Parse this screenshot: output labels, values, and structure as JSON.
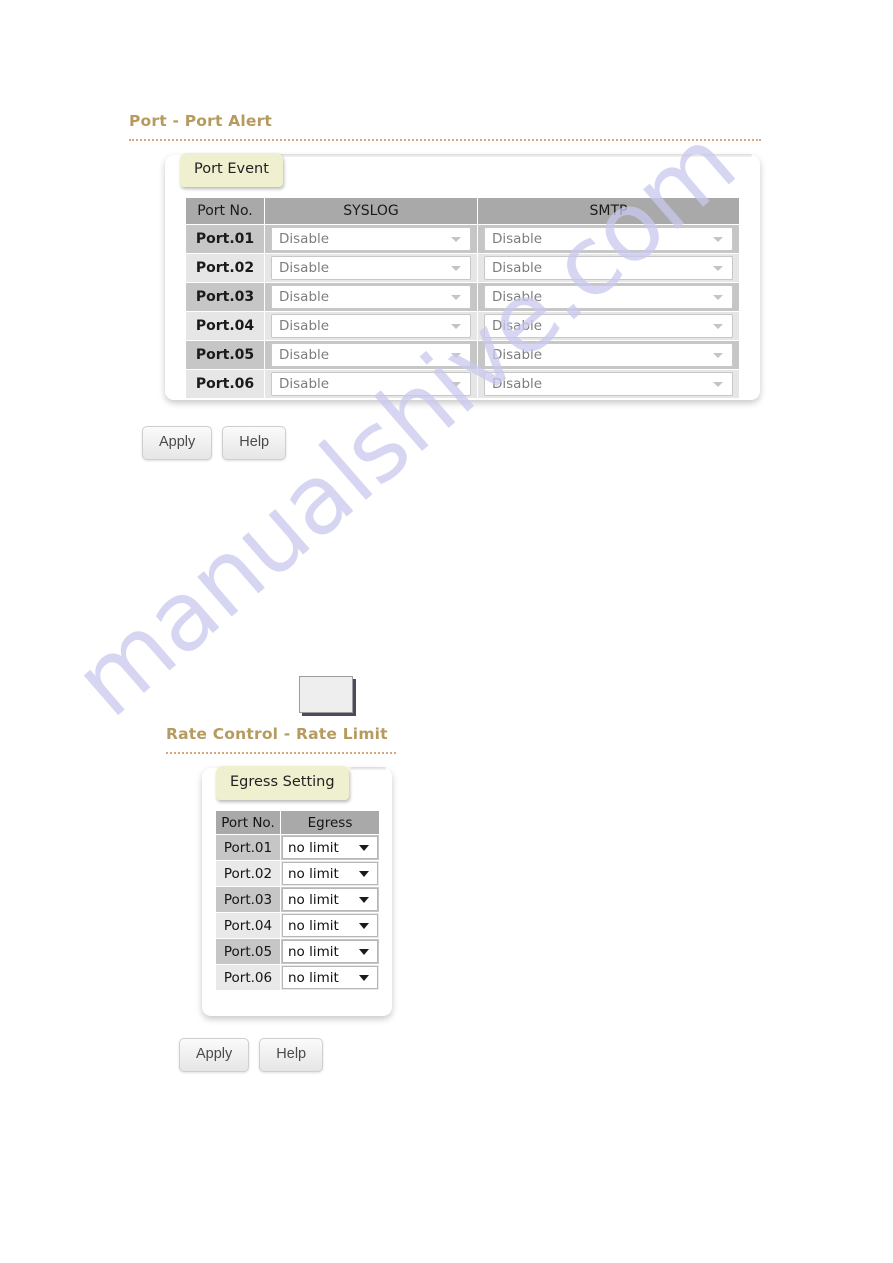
{
  "watermark": {
    "text": "manualshive.com"
  },
  "sections": [
    {
      "title": "Port - Port Alert",
      "tab_label": "Port Event",
      "table": {
        "headers": [
          "Port No.",
          "SYSLOG",
          "SMTP"
        ],
        "rows": [
          {
            "port": "Port.01",
            "syslog": "Disable",
            "smtp": "Disable"
          },
          {
            "port": "Port.02",
            "syslog": "Disable",
            "smtp": "Disable"
          },
          {
            "port": "Port.03",
            "syslog": "Disable",
            "smtp": "Disable"
          },
          {
            "port": "Port.04",
            "syslog": "Disable",
            "smtp": "Disable"
          },
          {
            "port": "Port.05",
            "syslog": "Disable",
            "smtp": "Disable"
          },
          {
            "port": "Port.06",
            "syslog": "Disable",
            "smtp": "Disable"
          }
        ]
      },
      "buttons": {
        "apply": "Apply",
        "help": "Help"
      }
    },
    {
      "title": "Rate Control - Rate Limit",
      "tab_label": "Egress Setting",
      "table": {
        "headers": [
          "Port No.",
          "Egress"
        ],
        "rows": [
          {
            "port": "Port.01",
            "egress": "no limit"
          },
          {
            "port": "Port.02",
            "egress": "no limit"
          },
          {
            "port": "Port.03",
            "egress": "no limit"
          },
          {
            "port": "Port.04",
            "egress": "no limit"
          },
          {
            "port": "Port.05",
            "egress": "no limit"
          },
          {
            "port": "Port.06",
            "egress": "no limit"
          }
        ]
      },
      "buttons": {
        "apply": "Apply",
        "help": "Help"
      }
    }
  ],
  "colors": {
    "heading": "#b79a5e",
    "rule": "#d8a77a",
    "tab_bg": "#eef0d0",
    "table_header_bg": "#a9a9a9",
    "row_odd": "#c6c6c6",
    "row_even": "#e6e6e6",
    "watermark": "#c9c9ef"
  }
}
